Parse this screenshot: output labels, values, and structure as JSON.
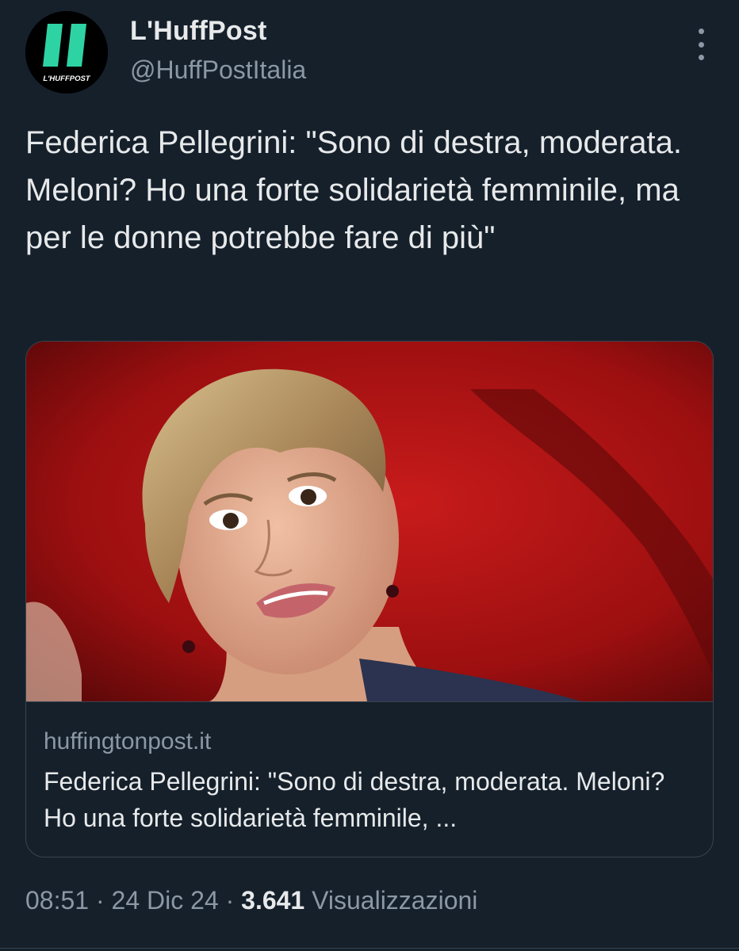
{
  "author": {
    "name": "L'HuffPost",
    "handle": "@HuffPostItalia",
    "avatar_logo_text": "L'HUFFPOST",
    "avatar_accent_color": "#2ed3a4"
  },
  "tweet": {
    "text": "Federica Pellegrini: \"Sono di destra, moderata. Meloni? Ho una forte solidarietà femminile, ma per le donne potrebbe fare di più\""
  },
  "link_card": {
    "image_description_icon": "photo",
    "domain": "huffingtonpost.it",
    "title": "Federica Pellegrini: \"Sono di destra, moderata. Meloni? Ho una forte solidarietà femminile, ..."
  },
  "meta": {
    "time": "08:51",
    "separator": "·",
    "date": "24 Dic 24",
    "views_count": "3.641",
    "views_label": "Visualizzazioni"
  },
  "colors": {
    "background": "#15202b",
    "text_primary": "#e7e9ea",
    "text_secondary": "#8b98a5",
    "border": "#38444d"
  },
  "icons": {
    "more": "more-vertical-icon"
  }
}
